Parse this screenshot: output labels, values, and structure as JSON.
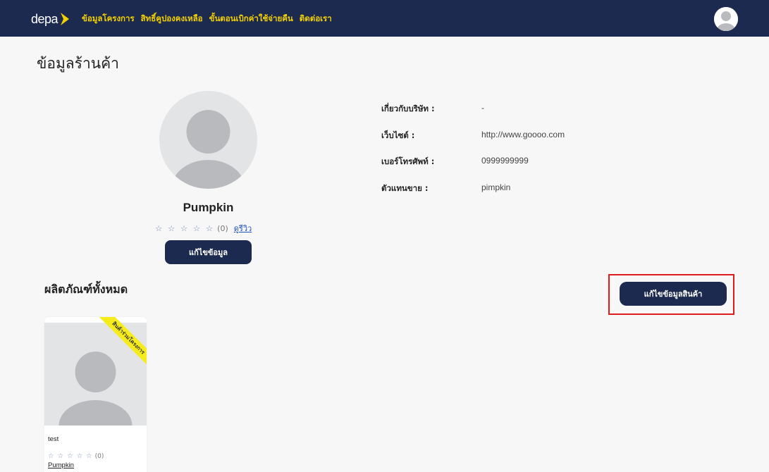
{
  "header": {
    "logo_text": "depa",
    "nav": [
      {
        "label": "ข้อมูลโครงการ"
      },
      {
        "label": "สิทธิ์คูปองคงเหลือ"
      },
      {
        "label": "ขั้นตอนเบิกค่าใช้จ่ายคืน"
      },
      {
        "label": "ติดต่อเรา"
      }
    ],
    "nav_color": "#f5d000",
    "bar_color": "#1b2a4e"
  },
  "page": {
    "title": "ข้อมูลร้านค้า"
  },
  "profile": {
    "shop_name": "Pumpkin",
    "stars": "☆ ☆ ☆ ☆ ☆",
    "review_count": "(0)",
    "review_link": "ดูรีวิว",
    "edit_button": "แก้ไขข้อมูล"
  },
  "info": [
    {
      "label": "เกี่ยวกับบริษัท :",
      "value": "-"
    },
    {
      "label": "เว็บไซต์ :",
      "value": "http://www.goooo.com"
    },
    {
      "label": "เบอร์โทรศัพท์ :",
      "value": "0999999999"
    },
    {
      "label": "ตัวแทนขาย :",
      "value": "pimpkin"
    }
  ],
  "products": {
    "section_title": "ผลิตภัณฑ์ทั้งหมด",
    "edit_button": "แก้ไขข้อมูลสินค้า",
    "items": [
      {
        "ribbon": "สินค้าร่วมโครงการ",
        "name": "test",
        "stars": "☆ ☆ ☆ ☆ ☆",
        "review_count": "(0)",
        "shop": "Pumpkin"
      }
    ]
  },
  "colors": {
    "primary": "#1b2a4e",
    "highlight": "#e01b1b",
    "ribbon": "#f6ec1c",
    "link": "#1a4fc0"
  }
}
